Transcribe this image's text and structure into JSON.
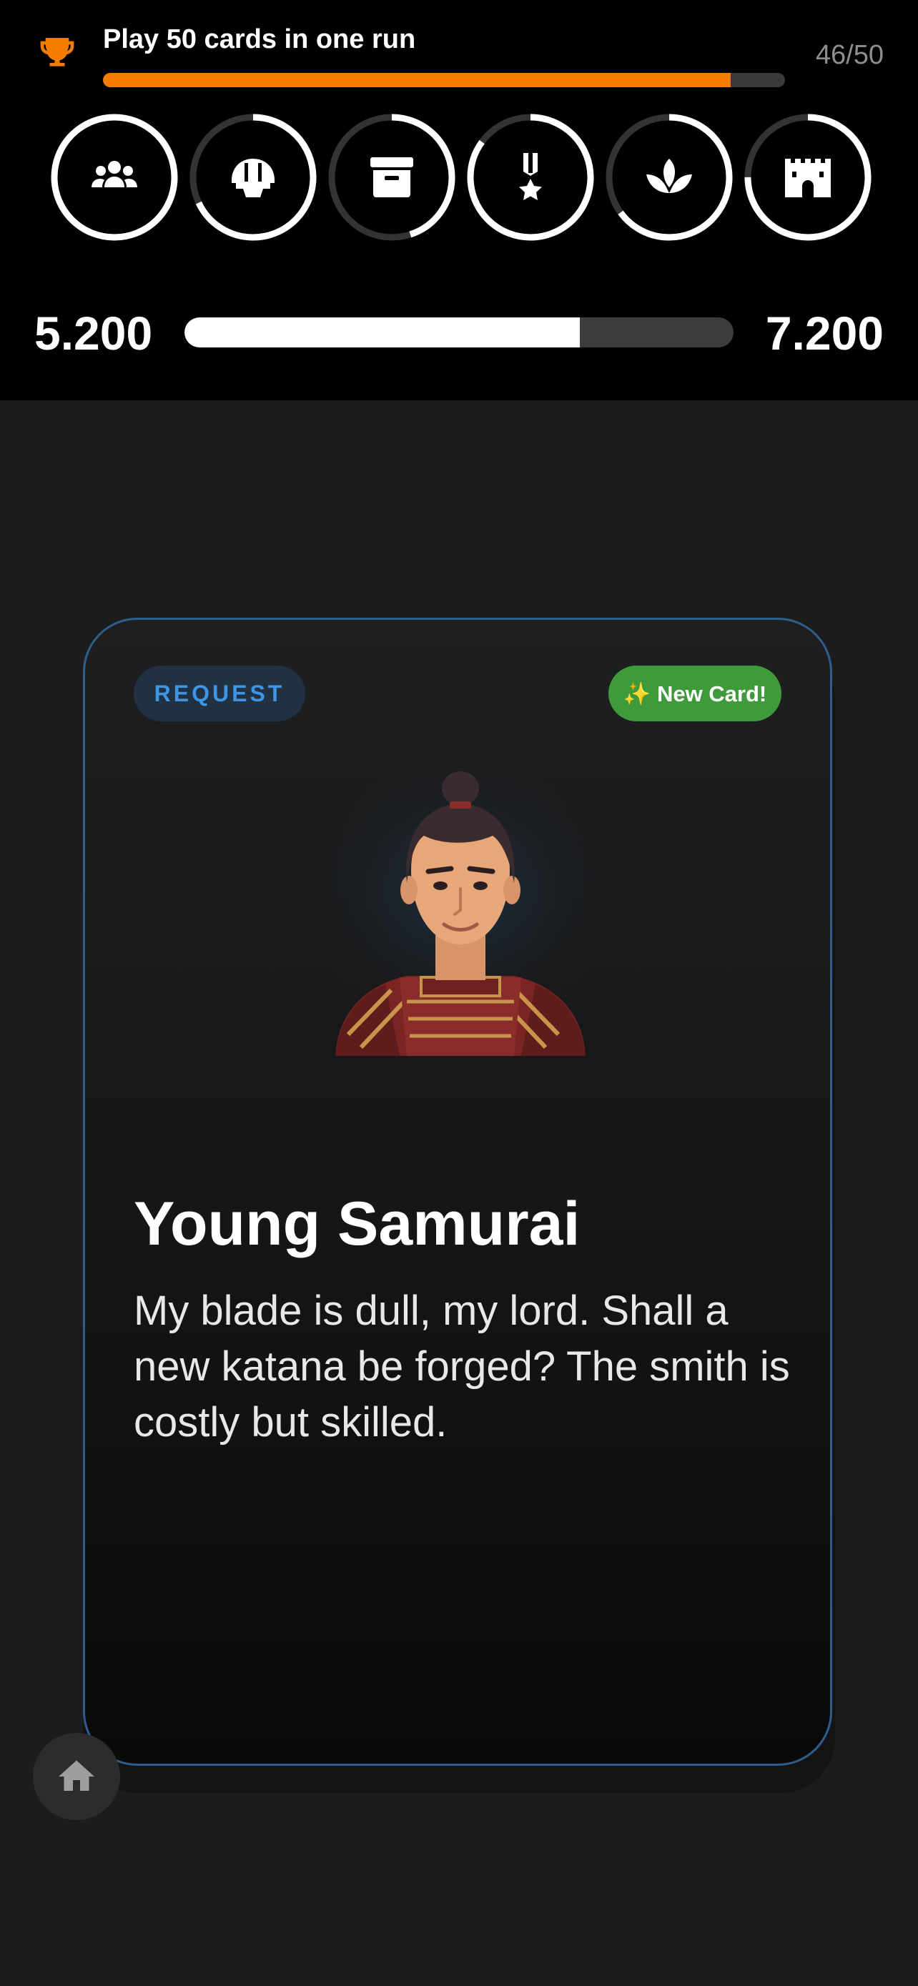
{
  "achievement": {
    "icon": "trophy-icon",
    "title": "Play 50 cards in one run",
    "count_text": "46/50",
    "progress": 0.92,
    "accent_color": "#f57c00"
  },
  "stats": [
    {
      "icon": "people-icon",
      "level": 1.0
    },
    {
      "icon": "helmet-icon",
      "level": 0.68
    },
    {
      "icon": "archive-box-icon",
      "level": 0.45
    },
    {
      "icon": "medal-icon",
      "level": 0.85
    },
    {
      "icon": "lotus-icon",
      "level": 0.65
    },
    {
      "icon": "castle-icon",
      "level": 0.75
    }
  ],
  "score": {
    "current": "5.200",
    "goal": "7.200",
    "progress": 0.72
  },
  "card": {
    "type_label": "REQUEST",
    "new_badge": "✨ New Card!",
    "name": "Young Samurai",
    "text": "My blade is dull, my lord. Shall a new katana be forged? The smith is costly but skilled.",
    "border_color": "#2e5f8c"
  },
  "nav": {
    "home_icon": "home-icon"
  }
}
